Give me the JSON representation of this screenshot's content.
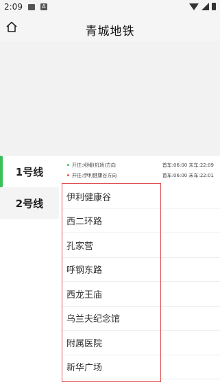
{
  "status_bar": {
    "time": "2:09",
    "a_icon": "A"
  },
  "header": {
    "title": "青城地铁"
  },
  "lines": [
    {
      "label": "1号线",
      "active": true
    },
    {
      "label": "2号线",
      "active": false
    }
  ],
  "directions": [
    {
      "text": "开往:坝堰(机场)方向",
      "times": "首车:06:00 末车:22:09",
      "dot_color": "#3cbf5a"
    },
    {
      "text": "开往:伊利健康谷方向",
      "times": "首车:06:00 末车:22:01",
      "dot_color": "#e05050"
    }
  ],
  "stations": [
    "伊利健康谷",
    "西二环路",
    "孔家营",
    "呼钢东路",
    "西龙王庙",
    "乌兰夫纪念馆",
    "附属医院",
    "新华广场"
  ],
  "colors": {
    "accent": "#3cbf5a",
    "highlight": "#e05050"
  }
}
